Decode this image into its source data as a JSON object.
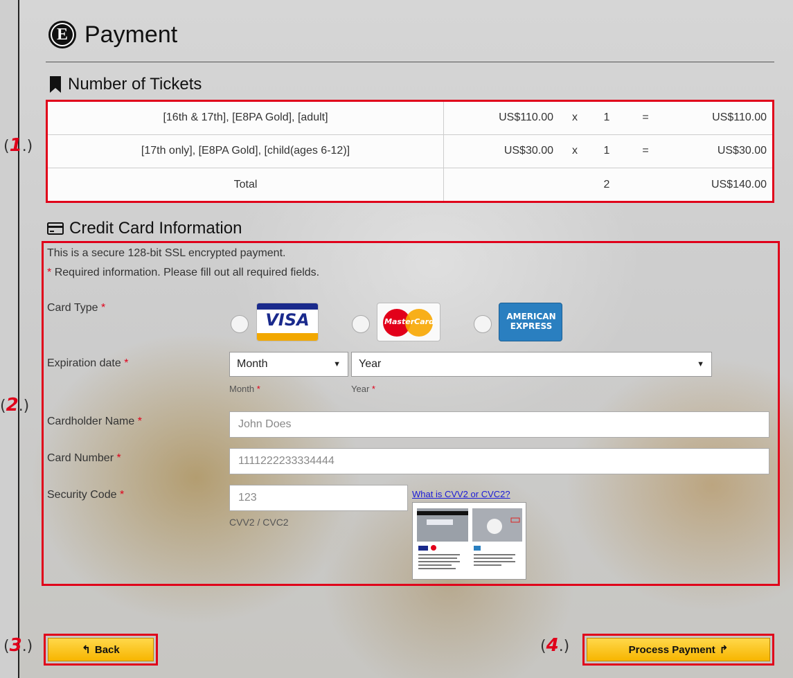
{
  "page": {
    "title": "Payment"
  },
  "markers": [
    "1",
    "2",
    "3",
    "4"
  ],
  "tickets": {
    "heading": "Number of Tickets",
    "rows": [
      {
        "description": "[16th & 17th], [E8PA Gold], [adult]",
        "price": "US$110.00",
        "times": "x",
        "qty": "1",
        "equals": "=",
        "subtotal": "US$110.00"
      },
      {
        "description": "[17th only], [E8PA Gold], [child(ages 6-12)]",
        "price": "US$30.00",
        "times": "x",
        "qty": "1",
        "equals": "=",
        "subtotal": "US$30.00"
      }
    ],
    "total": {
      "label": "Total",
      "qty": "2",
      "amount": "US$140.00"
    }
  },
  "credit_card": {
    "heading": "Credit Card Information",
    "secure_note": "This is a secure 128-bit SSL encrypted payment.",
    "required_note": "Required information. Please fill out all required fields.",
    "required_mark": "*",
    "card_type_label": "Card Type",
    "card_types": [
      {
        "name": "VISA",
        "icon": "visa-logo"
      },
      {
        "name": "MasterCard",
        "icon": "mastercard-logo"
      },
      {
        "name": "AMERICAN EXPRESS",
        "icon": "amex-logo"
      }
    ],
    "expiration_label": "Expiration date",
    "month_select": {
      "value": "Month",
      "caption": "Month"
    },
    "year_select": {
      "value": "Year",
      "caption": "Year"
    },
    "cardholder_label": "Cardholder Name",
    "cardholder_placeholder": "John Does",
    "card_number_label": "Card Number",
    "card_number_placeholder": "1111222233334444",
    "security_label": "Security Code",
    "security_placeholder": "123",
    "security_caption": "CVV2 / CVC2",
    "cvv_link": "What is CVV2 or CVC2?"
  },
  "actions": {
    "back_label": "Back",
    "process_label": "Process Payment"
  },
  "colors": {
    "accent_red": "#e0001a",
    "button_yellow": "#f7b500"
  }
}
